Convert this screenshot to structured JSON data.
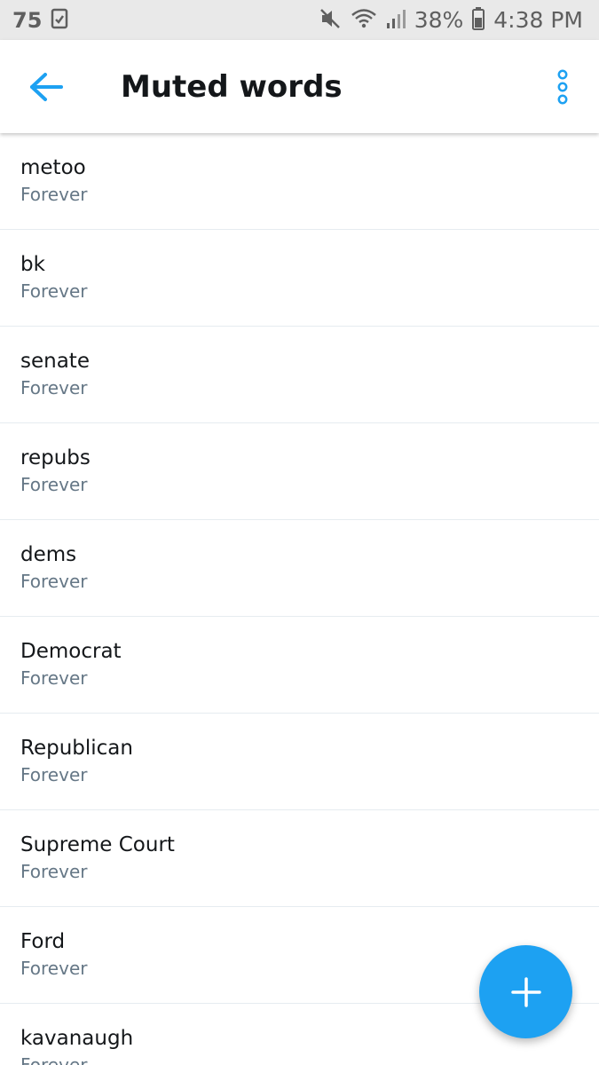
{
  "status_bar": {
    "temperature": "75",
    "battery_percent": "38%",
    "time": "4:38 PM",
    "icons": [
      "task-check-icon",
      "mute-icon",
      "wifi-icon",
      "signal-icon",
      "battery-icon"
    ]
  },
  "app_bar": {
    "title": "Muted words",
    "back_icon": "arrow-left-icon",
    "menu_icon": "more-vertical-icon"
  },
  "muted_words": [
    {
      "term": "metoo",
      "duration": "Forever"
    },
    {
      "term": "bk",
      "duration": "Forever"
    },
    {
      "term": "senate",
      "duration": "Forever"
    },
    {
      "term": "repubs",
      "duration": "Forever"
    },
    {
      "term": "dems",
      "duration": "Forever"
    },
    {
      "term": "Democrat",
      "duration": "Forever"
    },
    {
      "term": "Republican",
      "duration": "Forever"
    },
    {
      "term": "Supreme Court",
      "duration": "Forever"
    },
    {
      "term": "Ford",
      "duration": "Forever"
    },
    {
      "term": "kavanaugh",
      "duration": "Forever"
    }
  ],
  "fab": {
    "icon": "plus-icon"
  },
  "colors": {
    "accent": "#1da1f2",
    "status_bar_bg": "#e9e9e9",
    "primary_text": "#14171a",
    "secondary_text": "#657786",
    "divider": "#e6ecf0"
  }
}
